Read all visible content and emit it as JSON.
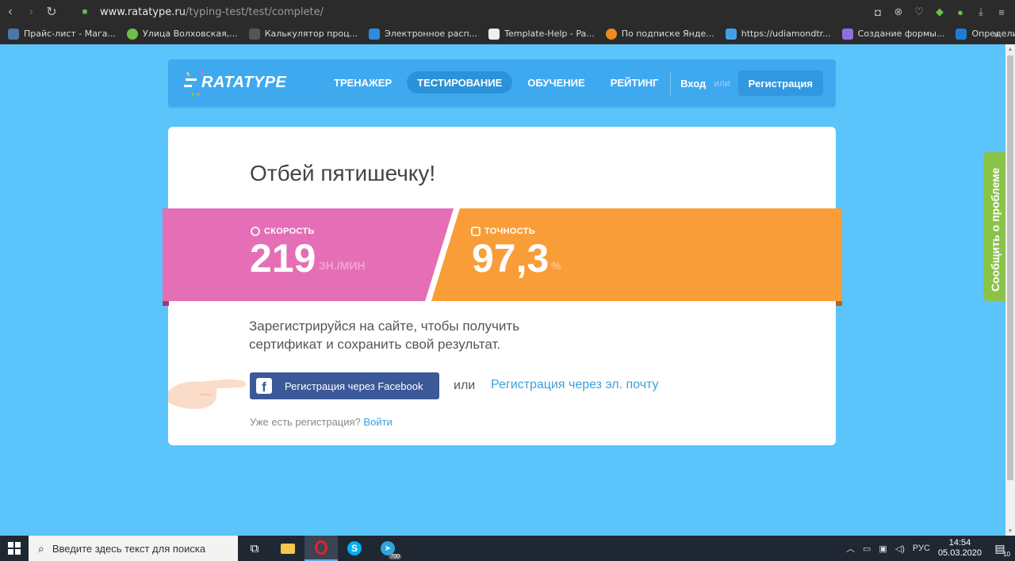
{
  "browser": {
    "url_host": "www.ratatype.ru",
    "url_path": "/typing-test/test/complete/",
    "bookmarks": [
      {
        "label": "Прайс-лист - Мага...",
        "color": "#4a76a8"
      },
      {
        "label": "Улица Волховская,...",
        "color": "#6cc04a"
      },
      {
        "label": "Калькулятор проц...",
        "color": "#333333"
      },
      {
        "label": "Электронное расп...",
        "color": "#2d8ce0"
      },
      {
        "label": "Template-Help - Pa...",
        "color": "#eeeeee"
      },
      {
        "label": "По подписке Янде...",
        "color": "#f08a24"
      },
      {
        "label": "https://udiamondtr...",
        "color": "#3ea0e8"
      },
      {
        "label": "Создание формы...",
        "color": "#8e6fe0"
      },
      {
        "label": "Определить CMS с...",
        "color": "#1f7cd6"
      }
    ]
  },
  "header": {
    "logo_text": "RATATYPE",
    "nav": [
      "ТРЕНАЖЕР",
      "ТЕСТИРОВАНИЕ",
      "ОБУЧЕНИЕ",
      "РЕЙТИНГ"
    ],
    "login": "Вход",
    "or": "или",
    "register": "Регистрация"
  },
  "result": {
    "headline": "Отбей пятишечку!",
    "speed_label": "СКОРОСТЬ",
    "speed_value": "219",
    "speed_unit": "ЗН./МИН",
    "accuracy_label": "ТОЧНОСТЬ",
    "accuracy_value": "97,3",
    "accuracy_unit": "%",
    "register_prompt_line1": "Зарегистрируйся на сайте, чтобы получить",
    "register_prompt_line2": "сертификат и сохранить свой результат.",
    "facebook_button": "Регистрация через Facebook",
    "or": "или",
    "email_link": "Регистрация через эл. почту",
    "already_text": "Уже есть регистрация?",
    "login_link": "Войти"
  },
  "report_tab": "Сообщить о проблеме",
  "taskbar": {
    "search_placeholder": "Введите здесь текст для поиска",
    "language": "РУС",
    "time": "14:54",
    "date": "05.03.2020",
    "telegram_badge": "700",
    "notifications": "10"
  },
  "colors": {
    "page_bg": "#5ac4fb",
    "speed_band": "#e46fb6",
    "accuracy_band": "#f99d39",
    "facebook": "#3b5998",
    "link": "#3ba0dd"
  }
}
